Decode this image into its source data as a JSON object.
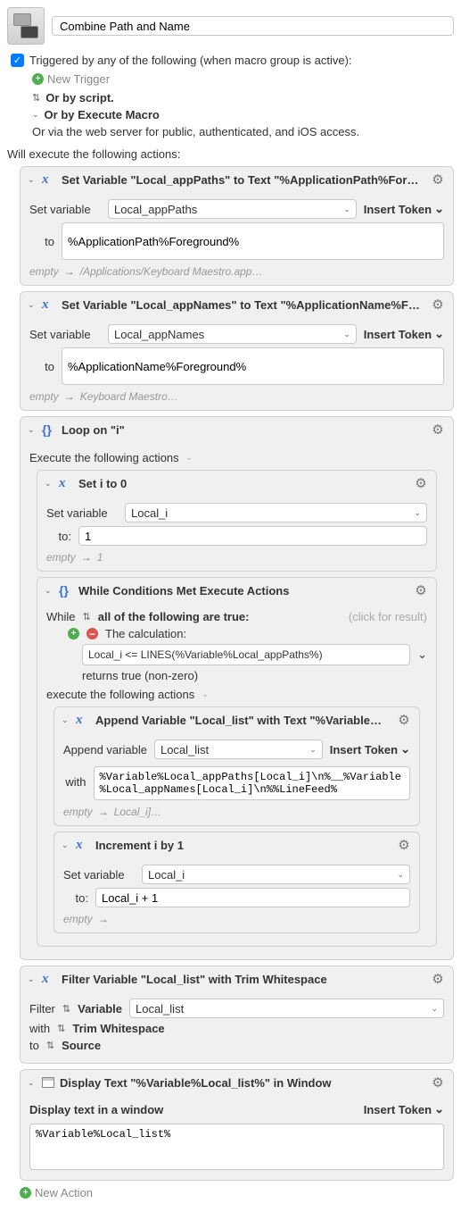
{
  "title": "Combine Path and Name",
  "triggered_label": "Triggered by any of the following (when macro group is active):",
  "new_trigger": "New Trigger",
  "or_by_script": "Or by script.",
  "or_by_execute": "Or by Execute Macro",
  "or_via_web": "Or via the web server for public, authenticated, and iOS access.",
  "will_execute": "Will execute the following actions:",
  "insert_token": "Insert Token",
  "new_action": "New Action",
  "empty": "empty",
  "actions": {
    "a1": {
      "title": "Set Variable \"Local_appPaths\" to Text \"%ApplicationPath%Foreground%\"",
      "set_variable_lbl": "Set variable",
      "var": "Local_appPaths",
      "to_lbl": "to",
      "to_val": "%ApplicationPath%Foreground%",
      "preview": "/Applications/Keyboard Maestro.app…"
    },
    "a2": {
      "title": "Set Variable \"Local_appNames\" to Text \"%ApplicationName%Foregroun…",
      "set_variable_lbl": "Set variable",
      "var": "Local_appNames",
      "to_lbl": "to",
      "to_val": "%ApplicationName%Foreground%",
      "preview": "Keyboard Maestro…"
    },
    "loop": {
      "title": "Loop on \"i\"",
      "execute_lbl": "Execute the following actions",
      "set_i": {
        "title": "Set i to 0",
        "set_variable_lbl": "Set variable",
        "var": "Local_i",
        "to_lbl": "to:",
        "to_val": "1",
        "preview": "1"
      },
      "while": {
        "title": "While Conditions Met Execute Actions",
        "while_lbl": "While",
        "mode": "all of the following are true:",
        "click_result": "(click for result)",
        "calc_lbl": "The calculation:",
        "calc": "Local_i <= LINES(%Variable%Local_appPaths%)",
        "returns": "returns true (non-zero)",
        "exec_lbl": "execute the following actions",
        "append": {
          "title": "Append Variable \"Local_list\" with Text \"%Variable%Local_a…",
          "append_lbl": "Append variable",
          "var": "Local_list",
          "with_lbl": "with",
          "with_val": "%Variable%Local_appPaths[Local_i]\\n%__%Variable%Local_appNames[Local_i]\\n%%LineFeed%",
          "preview": "Local_i]…"
        },
        "inc": {
          "title": "Increment i by 1",
          "set_variable_lbl": "Set variable",
          "var": "Local_i",
          "to_lbl": "to:",
          "to_val": "Local_i + 1",
          "preview": ""
        }
      }
    },
    "filter": {
      "title": "Filter Variable \"Local_list\" with Trim Whitespace",
      "filter_lbl": "Filter",
      "kind": "Variable",
      "var": "Local_list",
      "with_lbl": "with",
      "with_val": "Trim Whitespace",
      "to_lbl": "to",
      "to_val": "Source"
    },
    "display": {
      "title": "Display Text \"%Variable%Local_list%\" in Window",
      "mode": "Display text in a window",
      "text": "%Variable%Local_list%"
    }
  }
}
